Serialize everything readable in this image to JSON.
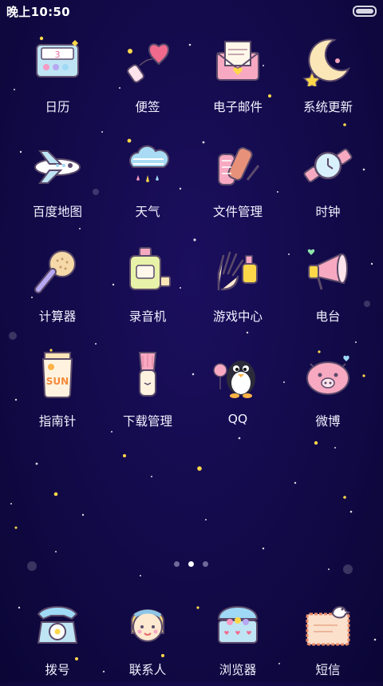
{
  "status_bar": {
    "time": "晚上10:50",
    "battery_level": 1.0
  },
  "apps": [
    {
      "label": "日历",
      "icon": "calendar-palette-icon"
    },
    {
      "label": "便签",
      "icon": "notes-heart-bottle-icon"
    },
    {
      "label": "电子邮件",
      "icon": "email-envelope-icon"
    },
    {
      "label": "系统更新",
      "icon": "moon-star-icon"
    },
    {
      "label": "百度地图",
      "icon": "airplane-icon"
    },
    {
      "label": "天气",
      "icon": "cloud-rain-icon"
    },
    {
      "label": "文件管理",
      "icon": "files-rolls-icon"
    },
    {
      "label": "时钟",
      "icon": "wristwatch-icon"
    },
    {
      "label": "计算器",
      "icon": "brush-comb-icon"
    },
    {
      "label": "录音机",
      "icon": "perfume-bottle-icon"
    },
    {
      "label": "游戏中心",
      "icon": "hand-nail-polish-icon"
    },
    {
      "label": "电台",
      "icon": "megaphone-icon"
    },
    {
      "label": "指南针",
      "icon": "sunscreen-tube-icon"
    },
    {
      "label": "下载管理",
      "icon": "makeup-brush-icon"
    },
    {
      "label": "QQ",
      "icon": "penguin-icon"
    },
    {
      "label": "微博",
      "icon": "pig-face-icon"
    }
  ],
  "page_indicator": {
    "pages": 3,
    "current": 2
  },
  "dock": [
    {
      "label": "拨号",
      "icon": "rotary-phone-icon"
    },
    {
      "label": "联系人",
      "icon": "girl-face-icon"
    },
    {
      "label": "浏览器",
      "icon": "jewelry-box-icon"
    },
    {
      "label": "短信",
      "icon": "bird-letter-icon"
    }
  ],
  "colors": {
    "background": "#120a48",
    "label_text": "#f4f1ff",
    "active_dot": "#ffffff",
    "inactive_dot": "#6f6a9a"
  }
}
